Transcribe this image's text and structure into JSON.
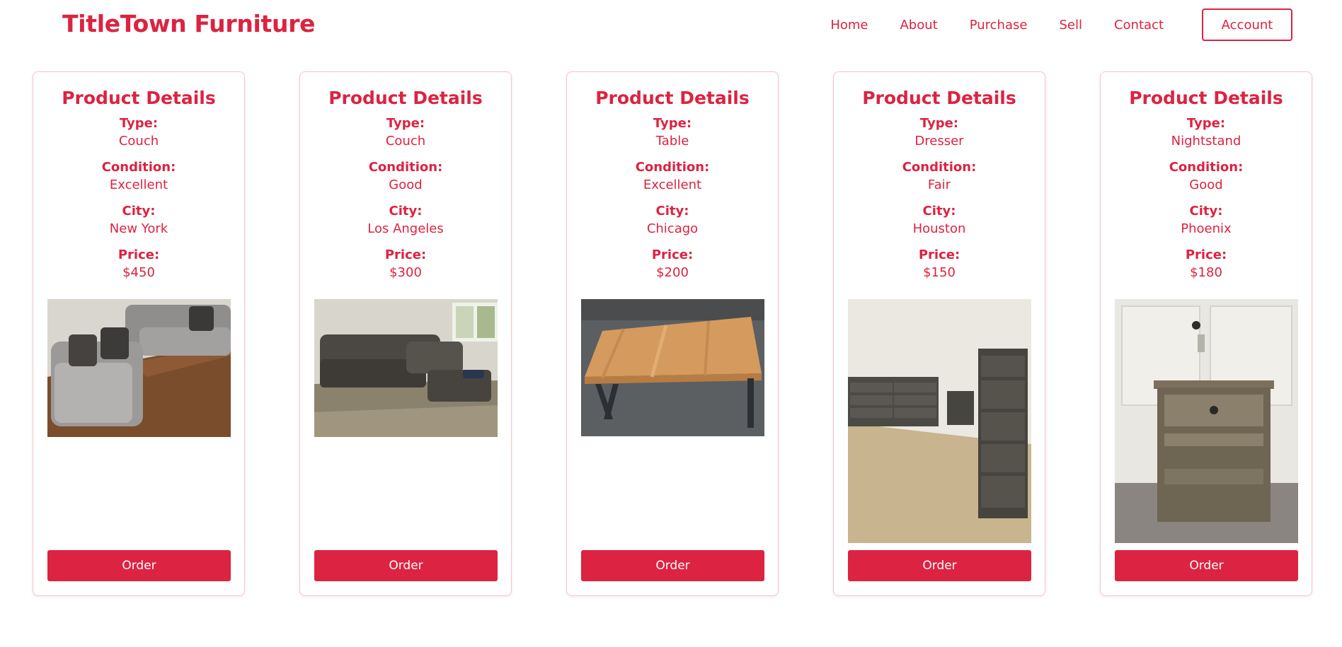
{
  "header": {
    "brand": "TitleTown Furniture",
    "nav": [
      "Home",
      "About",
      "Purchase",
      "Sell",
      "Contact"
    ],
    "account_label": "Account"
  },
  "labels": {
    "card_title": "Product Details",
    "type": "Type:",
    "condition": "Condition:",
    "city": "City:",
    "price": "Price:",
    "order": "Order"
  },
  "products": [
    {
      "type": "Couch",
      "condition": "Excellent",
      "city": "New York",
      "price": "$450",
      "photo": "gray-sectional-couch"
    },
    {
      "type": "Couch",
      "condition": "Good",
      "city": "Los Angeles",
      "price": "$300",
      "photo": "dark-sectional-couch"
    },
    {
      "type": "Table",
      "condition": "Excellent",
      "city": "Chicago",
      "price": "$200",
      "photo": "wooden-table"
    },
    {
      "type": "Dresser",
      "condition": "Fair",
      "city": "Houston",
      "price": "$150",
      "photo": "dresser-set"
    },
    {
      "type": "Nightstand",
      "condition": "Good",
      "city": "Phoenix",
      "price": "$180",
      "photo": "nightstand"
    }
  ],
  "colors": {
    "accent": "#dc2341",
    "card_border": "#f3c6cd"
  }
}
